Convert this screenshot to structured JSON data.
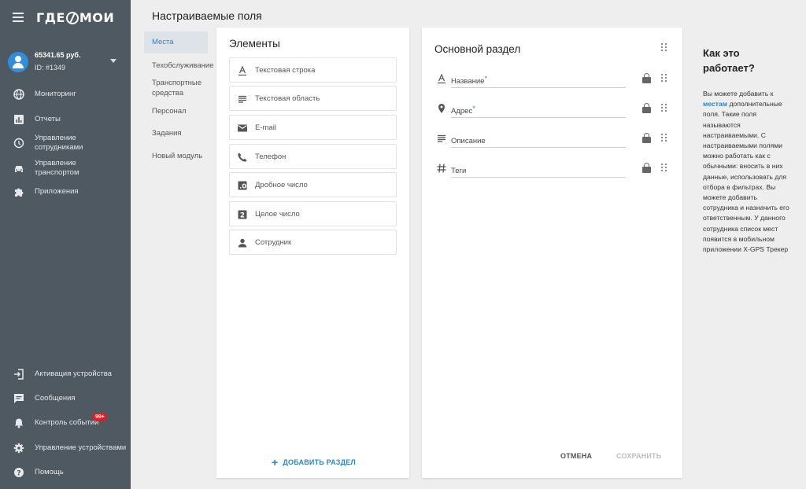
{
  "sidebar": {
    "logo": {
      "left": "ГДЕ",
      "right": "МОИ"
    },
    "account": {
      "balance": "65341.65 руб.",
      "id": "ID: #1349"
    },
    "items": [
      {
        "label": "Мониторинг",
        "icon": "globe-icon"
      },
      {
        "label": "Отчеты",
        "icon": "bar-chart-icon"
      },
      {
        "label": "Управление сотрудниками",
        "icon": "location-icon"
      },
      {
        "label": "Управление транспортом",
        "icon": "car-icon"
      },
      {
        "label": "Приложения",
        "icon": "puzzle-icon"
      }
    ],
    "bottom_items": [
      {
        "label": "Активация устройства",
        "icon": "login-icon"
      },
      {
        "label": "Сообщения",
        "icon": "chat-icon"
      },
      {
        "label": "Контроль событий",
        "icon": "bell-icon",
        "badge": "99+"
      },
      {
        "label": "Управление устройствами",
        "icon": "gear-icon"
      },
      {
        "label": "Помощь",
        "icon": "help-icon"
      }
    ],
    "badge_color": "#e51c23"
  },
  "header": {
    "title": "Настраиваемые поля"
  },
  "subnav": {
    "items": [
      {
        "label": "Места",
        "active": true
      },
      {
        "label": "Техобслуживание"
      },
      {
        "label": "Транспортные средства"
      },
      {
        "label": "Персонал"
      },
      {
        "label": "Задания"
      },
      {
        "label": "Новый модуль"
      }
    ]
  },
  "elements_panel": {
    "title": "Элементы",
    "items": [
      {
        "label": "Текстовая строка",
        "icon": "text-format-icon"
      },
      {
        "label": "Текстовая область",
        "icon": "text-lines-icon"
      },
      {
        "label": "E-mail",
        "icon": "email-icon"
      },
      {
        "label": "Телефон",
        "icon": "phone-icon"
      },
      {
        "label": "Дробное число",
        "icon": "decimal-icon"
      },
      {
        "label": "Целое число",
        "icon": "integer-icon"
      },
      {
        "label": "Сотрудник",
        "icon": "person-icon"
      }
    ],
    "add_section": "ДОБАВИТЬ РАЗДЕЛ"
  },
  "main_panel": {
    "title": "Основной раздел",
    "fields": [
      {
        "label": "Название",
        "required": "*",
        "icon": "text-format-icon"
      },
      {
        "label": "Адрес",
        "required": "*",
        "icon": "location-pin-icon"
      },
      {
        "label": "Описание",
        "required": "",
        "icon": "text-lines-icon"
      },
      {
        "label": "Теги",
        "required": "",
        "icon": "hash-icon"
      }
    ],
    "cancel": "ОТМЕНА",
    "save": "СОХРАНИТЬ"
  },
  "help": {
    "title": "Как это работает?",
    "text_before": "Вы можете добавить к ",
    "link": "местам",
    "text_after": " дополнительные поля. Такие поля называются настраиваемыми. С настраиваемыми полями можно работать как с обычными: вносить в них данные, использовать для отбора в фильтрах. Вы можете добавить сотрудника и назначить его ответственным. У данного сотрудника список мест появится в мобильном приложении X-GPS Трекер"
  },
  "colors": {
    "sidebar": "#4f5962",
    "accent": "#2a86c9",
    "avatar": "#2f8fde"
  }
}
